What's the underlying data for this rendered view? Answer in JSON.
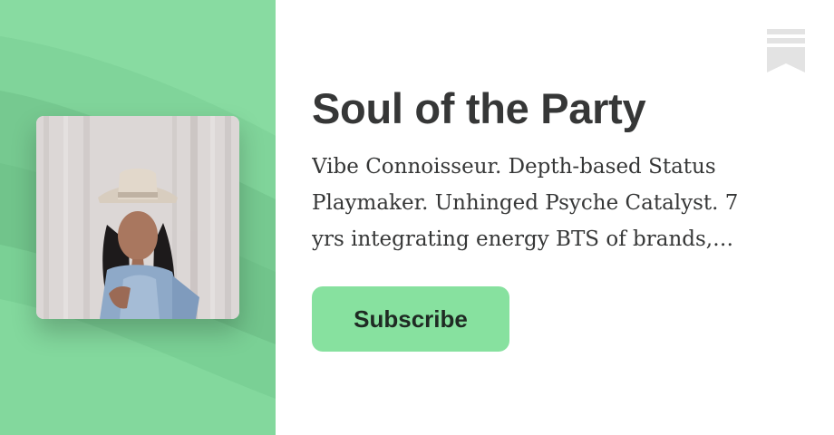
{
  "publication": {
    "title": "Soul of the Party",
    "description": "Vibe Connoisseur. Depth-based Status Playmaker. Unhinged Psyche Catalyst. 7 yrs integrating energy BTS of brands,…",
    "subscribe_label": "Subscribe"
  },
  "icons": {
    "bookmark": "bookmark-icon",
    "avatar": "profile-photo"
  },
  "colors": {
    "brand_green": "#7fd39a",
    "button_green": "#87e19f",
    "text_dark": "#363737",
    "icon_gray": "#e3e3e3"
  }
}
